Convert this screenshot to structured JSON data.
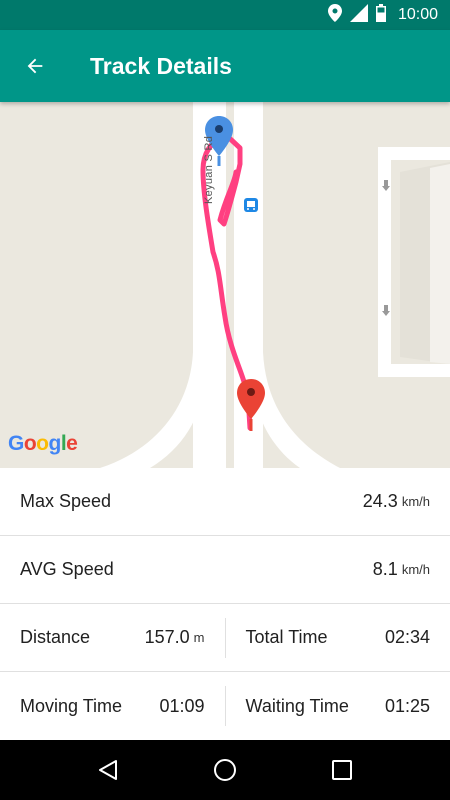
{
  "status_bar": {
    "time": "10:00",
    "icons": [
      "location-icon",
      "signal-icon",
      "battery-icon"
    ]
  },
  "app_bar": {
    "title": "Track Details",
    "back_icon": "arrow-left-icon"
  },
  "map": {
    "street_label": "Keyuan S Rd",
    "logo_text": "Google",
    "markers": [
      "start-marker-blue",
      "end-marker-red"
    ],
    "route_color": "#ff4081"
  },
  "stats": {
    "max_speed": {
      "label": "Max Speed",
      "value": "24.3",
      "unit": "km/h"
    },
    "avg_speed": {
      "label": "AVG Speed",
      "value": "8.1",
      "unit": "km/h"
    },
    "distance": {
      "label": "Distance",
      "value": "157.0",
      "unit": "m"
    },
    "total_time": {
      "label": "Total Time",
      "value": "02:34"
    },
    "moving_time": {
      "label": "Moving Time",
      "value": "01:09"
    },
    "waiting_time": {
      "label": "Waiting Time",
      "value": "01:25"
    }
  },
  "nav_bar": {
    "buttons": [
      "back-triangle-icon",
      "home-circle-icon",
      "recents-square-icon"
    ]
  },
  "colors": {
    "primary": "#009688",
    "primary_dark": "#00796b",
    "route": "#ff4081"
  }
}
